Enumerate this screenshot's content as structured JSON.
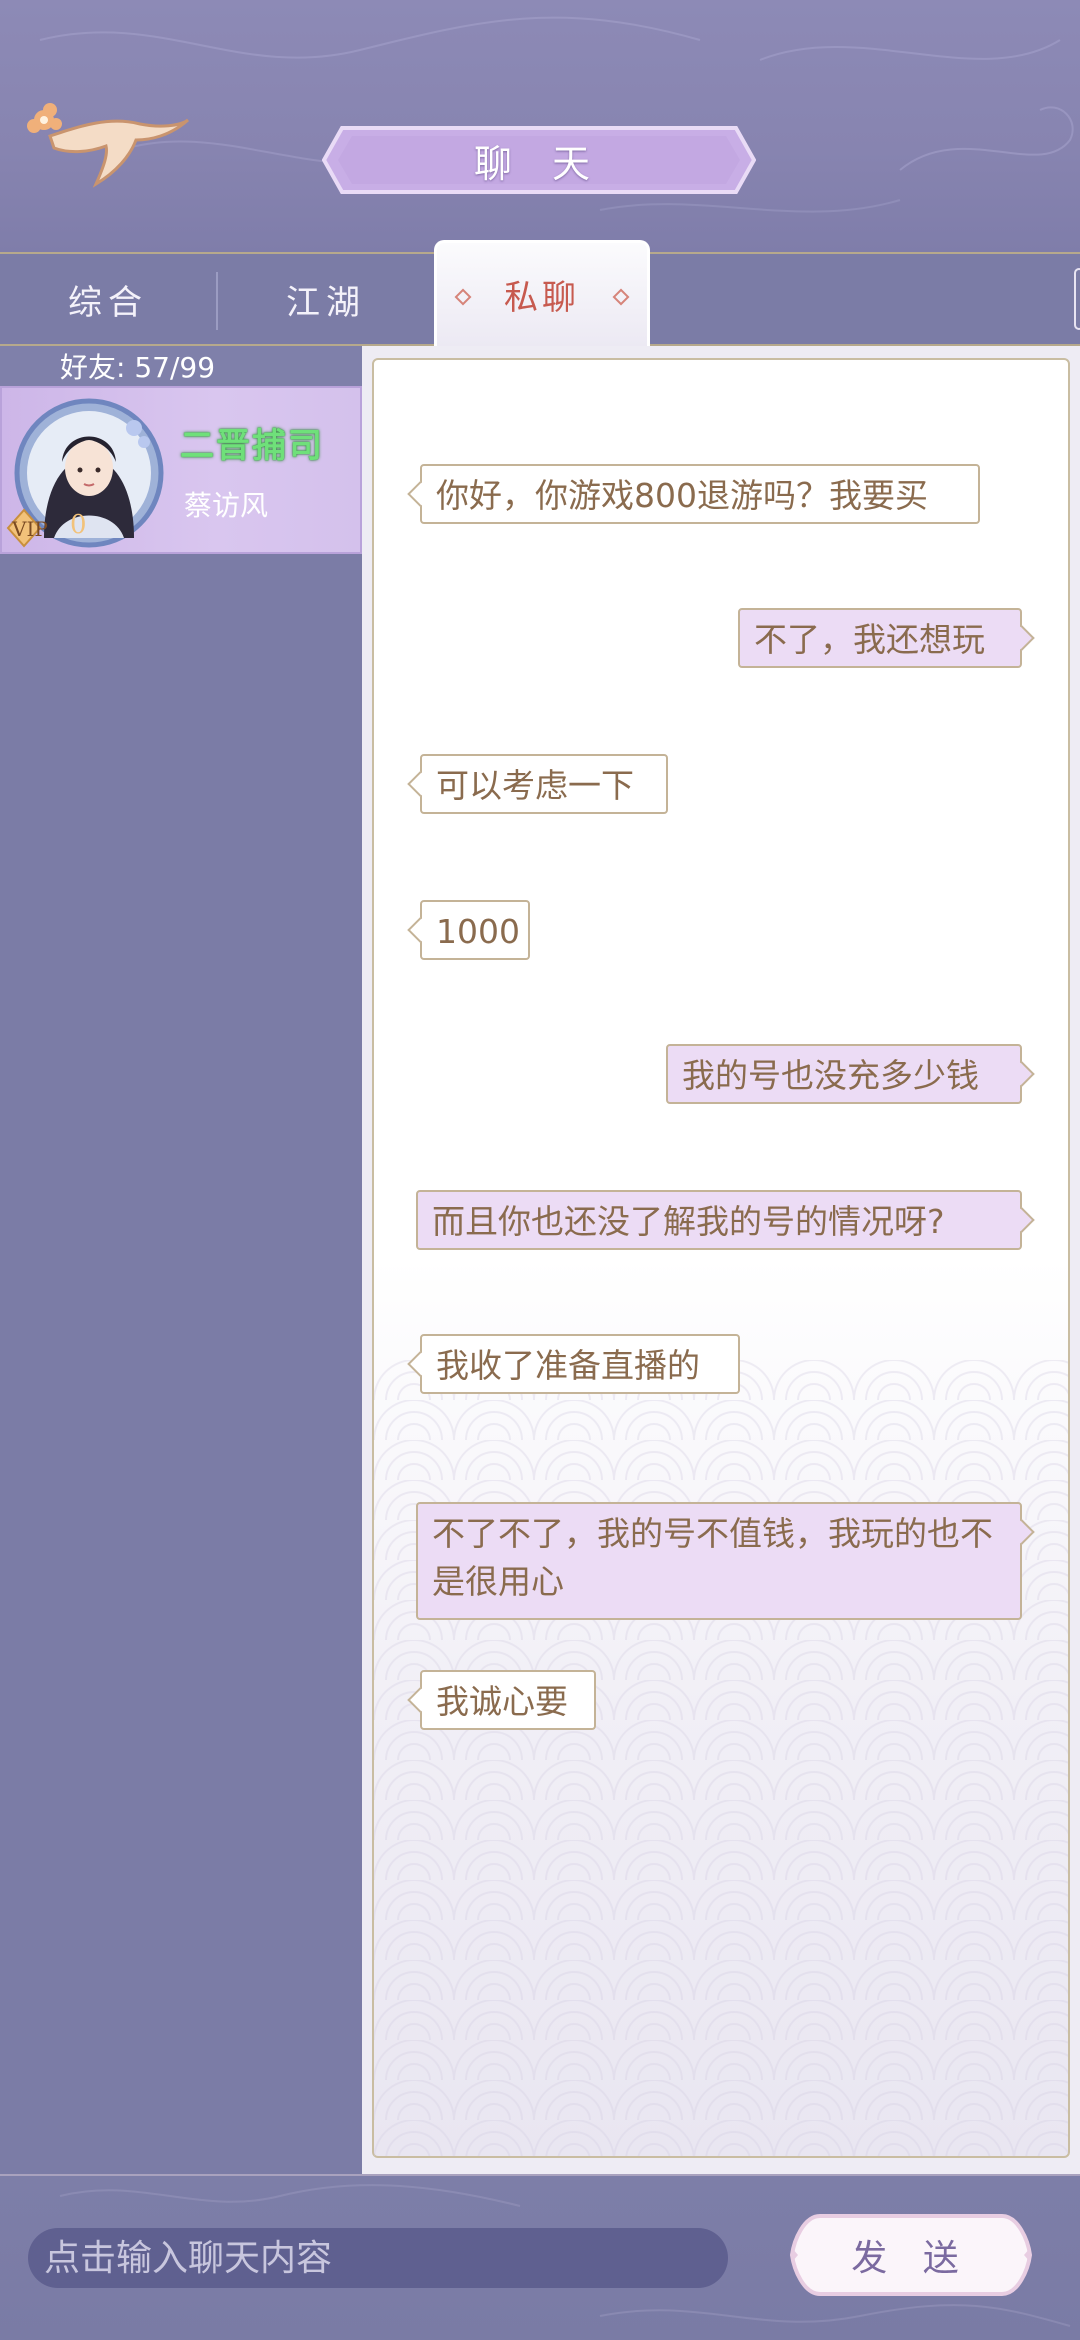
{
  "header": {
    "title": "聊 天"
  },
  "tabs": [
    {
      "label": "综合",
      "active": false
    },
    {
      "label": "江湖",
      "active": false
    },
    {
      "label": "私聊",
      "active": true
    }
  ],
  "friends": {
    "count_label": "好友: 57/99",
    "list": [
      {
        "name": "二晋捕司",
        "sub": "蔡访风",
        "vip_label": "VIP",
        "vip_level": "0"
      }
    ]
  },
  "messages": [
    {
      "side": "left",
      "text": "你好，你游戏800退游吗？我要买"
    },
    {
      "side": "right",
      "text": "不了，我还想玩"
    },
    {
      "side": "left",
      "text": "可以考虑一下"
    },
    {
      "side": "left",
      "text": "1000"
    },
    {
      "side": "right",
      "text": "我的号也没充多少钱"
    },
    {
      "side": "right",
      "text": "而且你也还没了解我的号的情况呀?"
    },
    {
      "side": "left",
      "text": "我收了准备直播的"
    },
    {
      "side": "right",
      "text": "不了不了，我的号不值钱，我玩的也不是很用心"
    },
    {
      "side": "left",
      "text": "我诚心要"
    }
  ],
  "input": {
    "placeholder": "点击输入聊天内容",
    "value": ""
  },
  "send": {
    "label": "发 送"
  },
  "colors": {
    "header_bg": "#8a87b3",
    "panel_bg": "#7b7ca6",
    "active_tab_text": "#c75a4f",
    "friend_name": "#6fe07a",
    "bubble_text": "#8a6b4e",
    "bubble_right_bg": "#ecdcf5",
    "bubble_border": "#c4b397"
  },
  "icons": {
    "swallow": "swallow-emblem-icon",
    "diamond": "diamond-ornament-icon",
    "vip": "vip-badge-icon"
  }
}
